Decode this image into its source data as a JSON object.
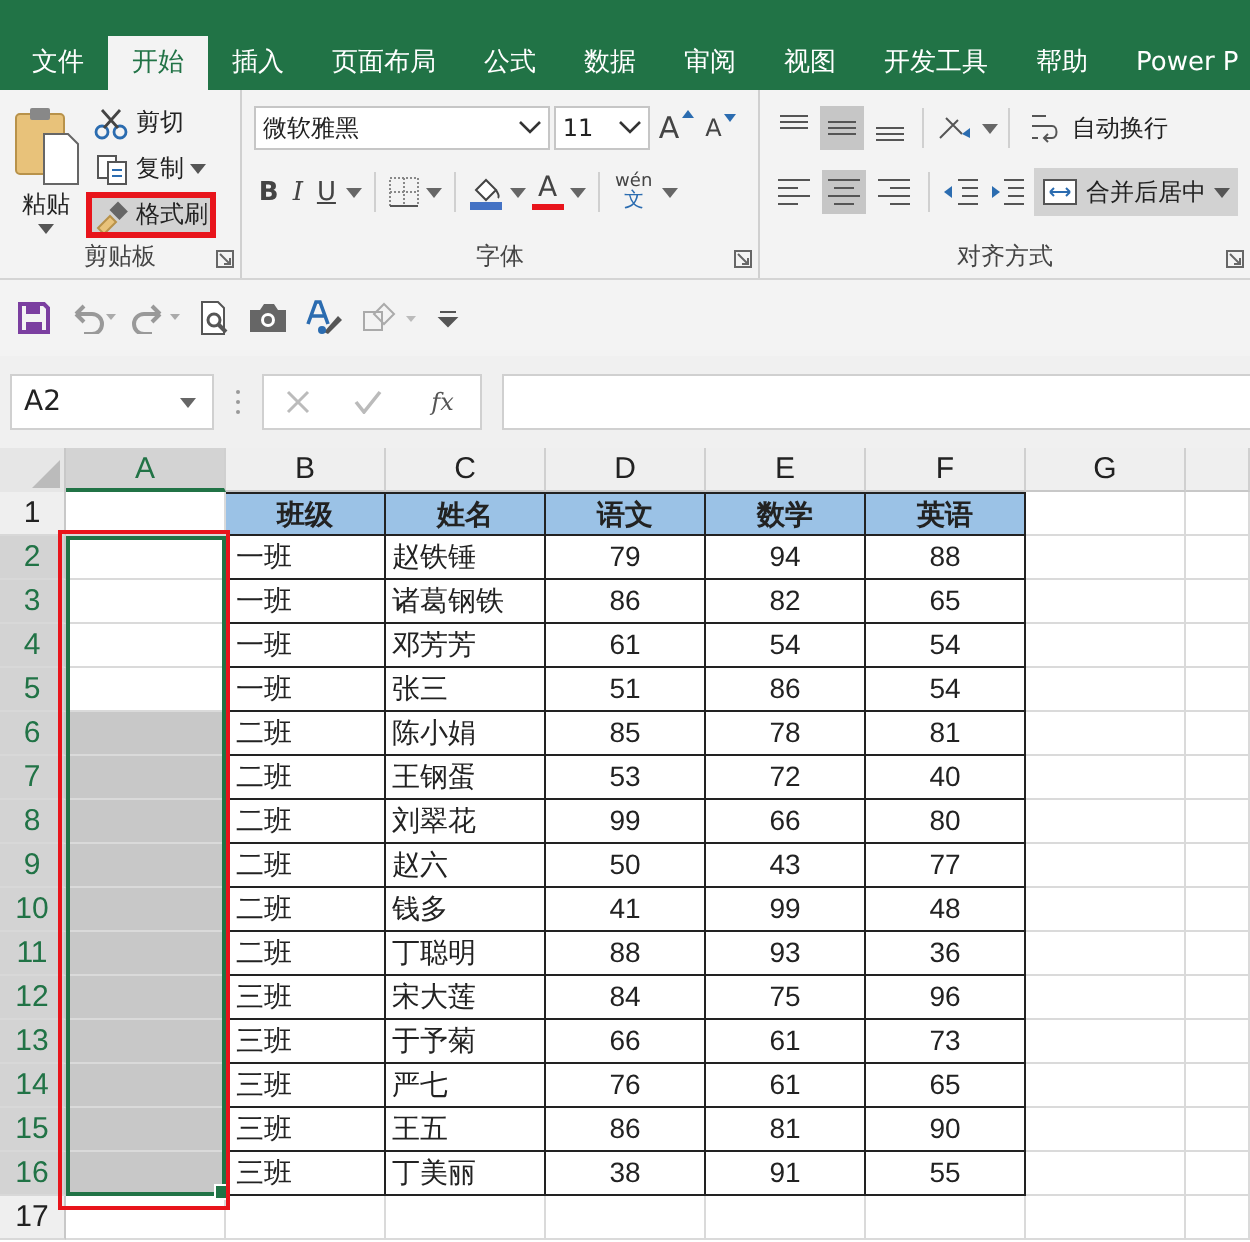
{
  "tabs": [
    {
      "label": "文件",
      "selected": false
    },
    {
      "label": "开始",
      "selected": true
    },
    {
      "label": "插入",
      "selected": false
    },
    {
      "label": "页面布局",
      "selected": false
    },
    {
      "label": "公式",
      "selected": false
    },
    {
      "label": "数据",
      "selected": false
    },
    {
      "label": "审阅",
      "selected": false
    },
    {
      "label": "视图",
      "selected": false
    },
    {
      "label": "开发工具",
      "selected": false
    },
    {
      "label": "帮助",
      "selected": false
    },
    {
      "label": "Power P",
      "selected": false
    }
  ],
  "clipboard": {
    "paste": "粘贴",
    "group_label": "剪贴板",
    "items": [
      {
        "label": "剪切",
        "kind": "cut",
        "highlighted": false
      },
      {
        "label": "复制",
        "kind": "copy",
        "highlighted": false
      },
      {
        "label": "格式刷",
        "kind": "painter",
        "highlighted": true
      }
    ]
  },
  "font": {
    "name": "微软雅黑",
    "size": "11",
    "grow": "A",
    "shrink": "A",
    "styles": [
      {
        "glyph": "B",
        "kind": "bold"
      },
      {
        "glyph": "I",
        "kind": "italic"
      },
      {
        "glyph": "U",
        "kind": "underline"
      }
    ],
    "font_color_glyph": "A",
    "phonetic_top": "wén",
    "phonetic_bottom": "文",
    "group_label": "字体"
  },
  "alignment": {
    "vertical": [
      {
        "kind": "top",
        "selected": false
      },
      {
        "kind": "middle",
        "selected": true
      },
      {
        "kind": "bottom",
        "selected": false
      }
    ],
    "horizontal": [
      {
        "kind": "left",
        "selected": false
      },
      {
        "kind": "center",
        "selected": true
      },
      {
        "kind": "right",
        "selected": false
      }
    ],
    "wrap": "自动换行",
    "merge": {
      "label": "合并后居中",
      "selected": true
    },
    "group_label": "对齐方式"
  },
  "name_box": "A2",
  "fx": "fx",
  "columns": [
    {
      "label": "A",
      "selected": true
    },
    {
      "label": "B",
      "selected": false
    },
    {
      "label": "C",
      "selected": false
    },
    {
      "label": "D",
      "selected": false
    },
    {
      "label": "E",
      "selected": false
    },
    {
      "label": "F",
      "selected": false
    },
    {
      "label": "G",
      "selected": false
    }
  ],
  "rows": [
    {
      "number": "1",
      "kind": "header",
      "selected": false,
      "cells": [
        "班级",
        "姓名",
        "语文",
        "数学",
        "英语"
      ]
    },
    {
      "number": "2",
      "kind": "data",
      "selected": true,
      "shaded": false,
      "cells": [
        "一班",
        "赵铁锤",
        "79",
        "94",
        "88"
      ]
    },
    {
      "number": "3",
      "kind": "data",
      "selected": true,
      "shaded": false,
      "cells": [
        "一班",
        "诸葛钢铁",
        "86",
        "82",
        "65"
      ]
    },
    {
      "number": "4",
      "kind": "data",
      "selected": true,
      "shaded": false,
      "cells": [
        "一班",
        "邓芳芳",
        "61",
        "54",
        "54"
      ]
    },
    {
      "number": "5",
      "kind": "data",
      "selected": true,
      "shaded": false,
      "cells": [
        "一班",
        "张三",
        "51",
        "86",
        "54"
      ]
    },
    {
      "number": "6",
      "kind": "data",
      "selected": true,
      "shaded": true,
      "cells": [
        "二班",
        "陈小娟",
        "85",
        "78",
        "81"
      ]
    },
    {
      "number": "7",
      "kind": "data",
      "selected": true,
      "shaded": true,
      "cells": [
        "二班",
        "王钢蛋",
        "53",
        "72",
        "40"
      ]
    },
    {
      "number": "8",
      "kind": "data",
      "selected": true,
      "shaded": true,
      "cells": [
        "二班",
        "刘翠花",
        "99",
        "66",
        "80"
      ]
    },
    {
      "number": "9",
      "kind": "data",
      "selected": true,
      "shaded": true,
      "cells": [
        "二班",
        "赵六",
        "50",
        "43",
        "77"
      ]
    },
    {
      "number": "10",
      "kind": "data",
      "selected": true,
      "shaded": true,
      "cells": [
        "二班",
        "钱多",
        "41",
        "99",
        "48"
      ]
    },
    {
      "number": "11",
      "kind": "data",
      "selected": true,
      "shaded": true,
      "cells": [
        "二班",
        "丁聪明",
        "88",
        "93",
        "36"
      ]
    },
    {
      "number": "12",
      "kind": "data",
      "selected": true,
      "shaded": true,
      "cells": [
        "三班",
        "宋大莲",
        "84",
        "75",
        "96"
      ]
    },
    {
      "number": "13",
      "kind": "data",
      "selected": true,
      "shaded": true,
      "cells": [
        "三班",
        "于予菊",
        "66",
        "61",
        "73"
      ]
    },
    {
      "number": "14",
      "kind": "data",
      "selected": true,
      "shaded": true,
      "cells": [
        "三班",
        "严七",
        "76",
        "61",
        "65"
      ]
    },
    {
      "number": "15",
      "kind": "data",
      "selected": true,
      "shaded": true,
      "cells": [
        "三班",
        "王五",
        "86",
        "81",
        "90"
      ]
    },
    {
      "number": "16",
      "kind": "data",
      "selected": true,
      "shaded": true,
      "cells": [
        "三班",
        "丁美丽",
        "38",
        "91",
        "55"
      ]
    },
    {
      "number": "17",
      "kind": "empty",
      "selected": false
    }
  ],
  "selection_highlighted": true
}
